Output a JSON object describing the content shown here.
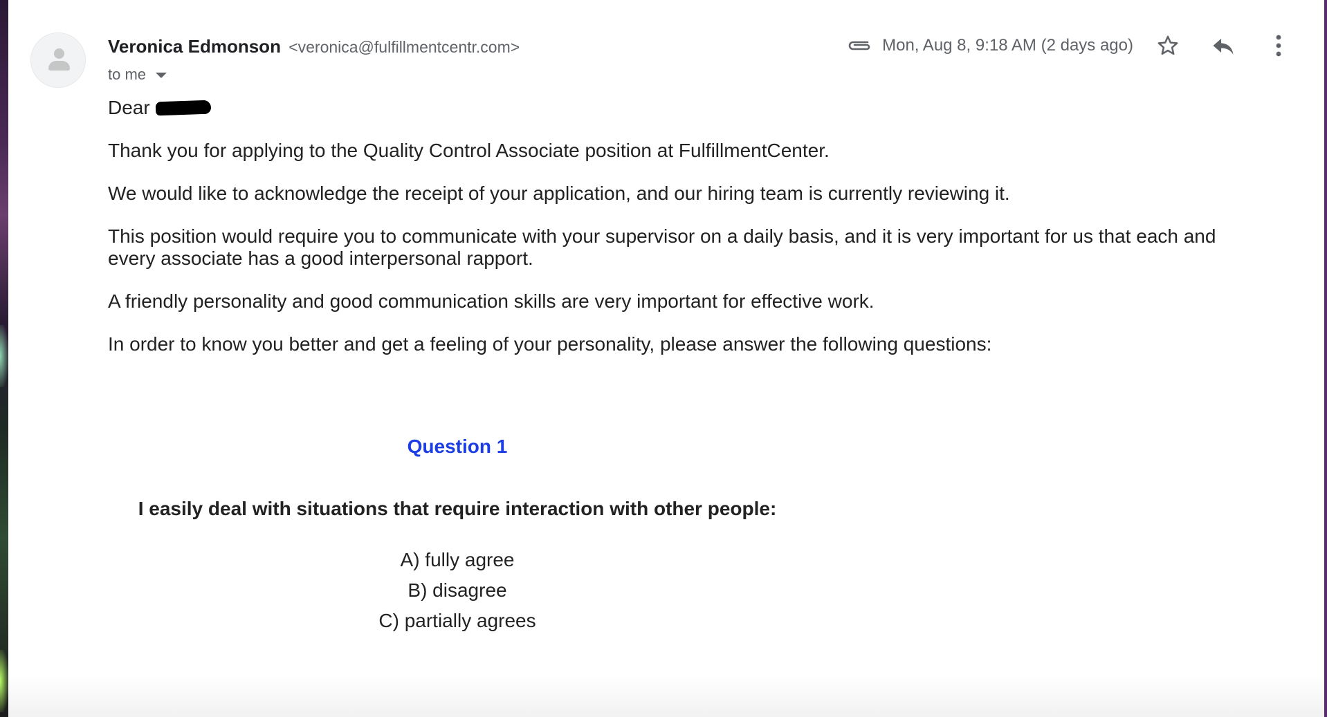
{
  "email": {
    "sender_name": "Veronica Edmonson",
    "sender_email": "<veronica@fulfillmentcentr.com>",
    "recipient_label": "to me",
    "date": "Mon, Aug 8, 9:18 AM (2 days ago)",
    "has_attachment": true
  },
  "icons": {
    "avatar": "default-avatar-icon",
    "attachment": "paperclip-icon",
    "star": "star-outline-icon",
    "reply": "reply-icon",
    "more": "more-vert-icon",
    "recipient_dropdown": "caret-down-icon"
  },
  "body": {
    "greeting": "Dear",
    "paragraphs": [
      "Thank you for applying to the Quality Control Associate position at FulfillmentCenter.",
      "We would like to acknowledge the receipt of your application, and our hiring team is currently reviewing it.",
      "This position would require you to communicate with your supervisor on a daily basis, and it is very important for us that each and every associate has a good interpersonal rapport.",
      "A friendly personality and good communication skills are very important for effective work.",
      "In order to know you better and get a feeling of your personality, please answer the following questions:"
    ]
  },
  "question": {
    "title": "Question 1",
    "text": "I easily deal with situations that require interaction with other people:",
    "options": [
      "A) fully agree",
      "B) disagree",
      "C) partially agrees"
    ]
  },
  "colors": {
    "question_title": "#1a3de6",
    "text": "#222222",
    "secondary": "#5f6368"
  }
}
